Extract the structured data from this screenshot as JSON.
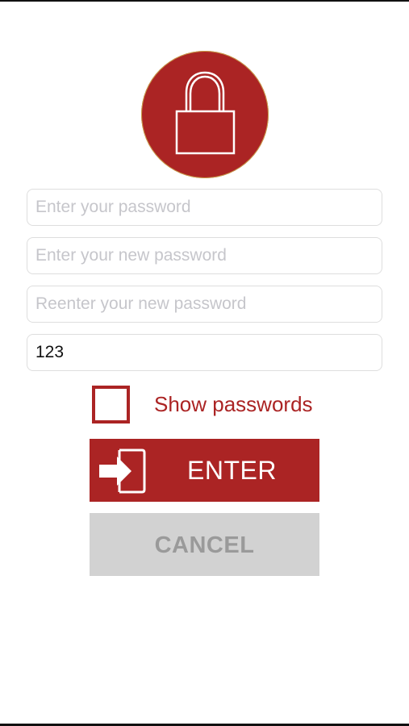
{
  "colors": {
    "accent": "#ab2424",
    "cancel_bg": "#d2d2d2",
    "cancel_text": "#9a9a9a",
    "placeholder": "#c6c6cb"
  },
  "header": {
    "icon": "lock-icon"
  },
  "form": {
    "current_password": {
      "value": "",
      "placeholder": "Enter your password"
    },
    "new_password": {
      "value": "",
      "placeholder": "Enter your new password"
    },
    "confirm_password": {
      "value": "",
      "placeholder": "Reenter your new password"
    },
    "fourth_field": {
      "value": "123",
      "placeholder": ""
    }
  },
  "show_passwords": {
    "label": "Show passwords",
    "checked": false
  },
  "actions": {
    "enter_label": "ENTER",
    "enter_icon": "enter-arrow-icon",
    "cancel_label": "CANCEL"
  }
}
